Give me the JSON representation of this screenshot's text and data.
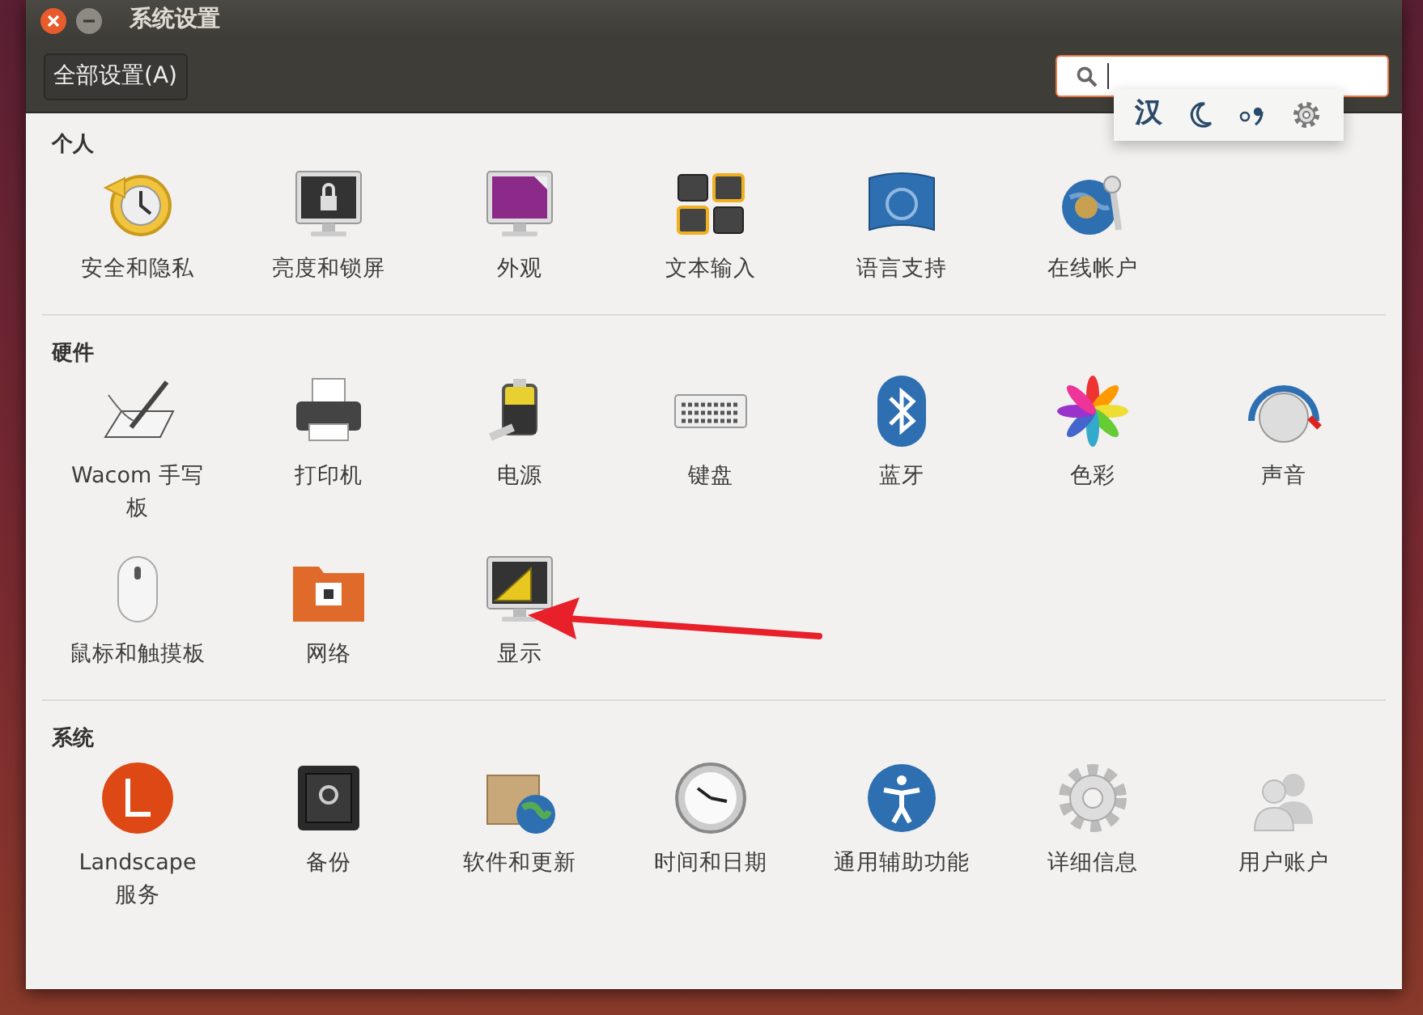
{
  "window": {
    "title": "系统设置"
  },
  "toolbar": {
    "all_settings_button": "全部设置(A)"
  },
  "input_method_bar": {
    "mode_label": "汉"
  },
  "sections": [
    {
      "title": "个人",
      "items": [
        {
          "label": "安全和隐私"
        },
        {
          "label": "亮度和锁屏"
        },
        {
          "label": "外观"
        },
        {
          "label": "文本输入"
        },
        {
          "label": "语言支持"
        },
        {
          "label": "在线帐户"
        }
      ]
    },
    {
      "title": "硬件",
      "items": [
        {
          "label": "Wacom 手写板"
        },
        {
          "label": "打印机"
        },
        {
          "label": "电源"
        },
        {
          "label": "键盘"
        },
        {
          "label": "蓝牙"
        },
        {
          "label": "色彩"
        },
        {
          "label": "声音"
        },
        {
          "label": "鼠标和触摸板"
        },
        {
          "label": "网络"
        },
        {
          "label": "显示"
        }
      ]
    },
    {
      "title": "系统",
      "items": [
        {
          "label": "Landscape 服务"
        },
        {
          "label": "备份"
        },
        {
          "label": "软件和更新"
        },
        {
          "label": "时间和日期"
        },
        {
          "label": "通用辅助功能"
        },
        {
          "label": "详细信息"
        },
        {
          "label": "用户账户"
        }
      ]
    }
  ]
}
